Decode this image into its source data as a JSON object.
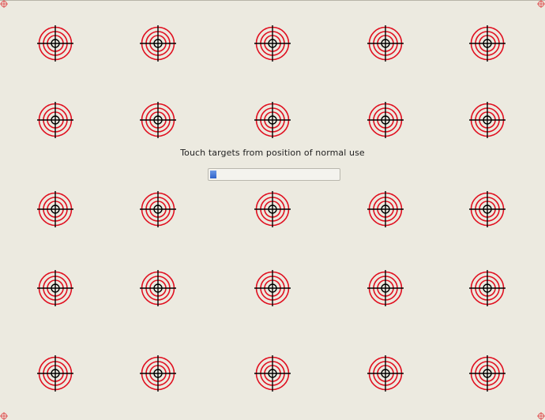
{
  "instruction": "Touch targets from position of normal use",
  "progress": 0.05,
  "target_rows": 5,
  "target_cols": 5,
  "colors": {
    "background": "#eceae0",
    "ring": "#e01020",
    "crosshair": "#000000",
    "progress_fill": "#2f62c8"
  },
  "icons": {
    "target": "touch-target-icon",
    "corner": "corner-crosshair-icon"
  }
}
